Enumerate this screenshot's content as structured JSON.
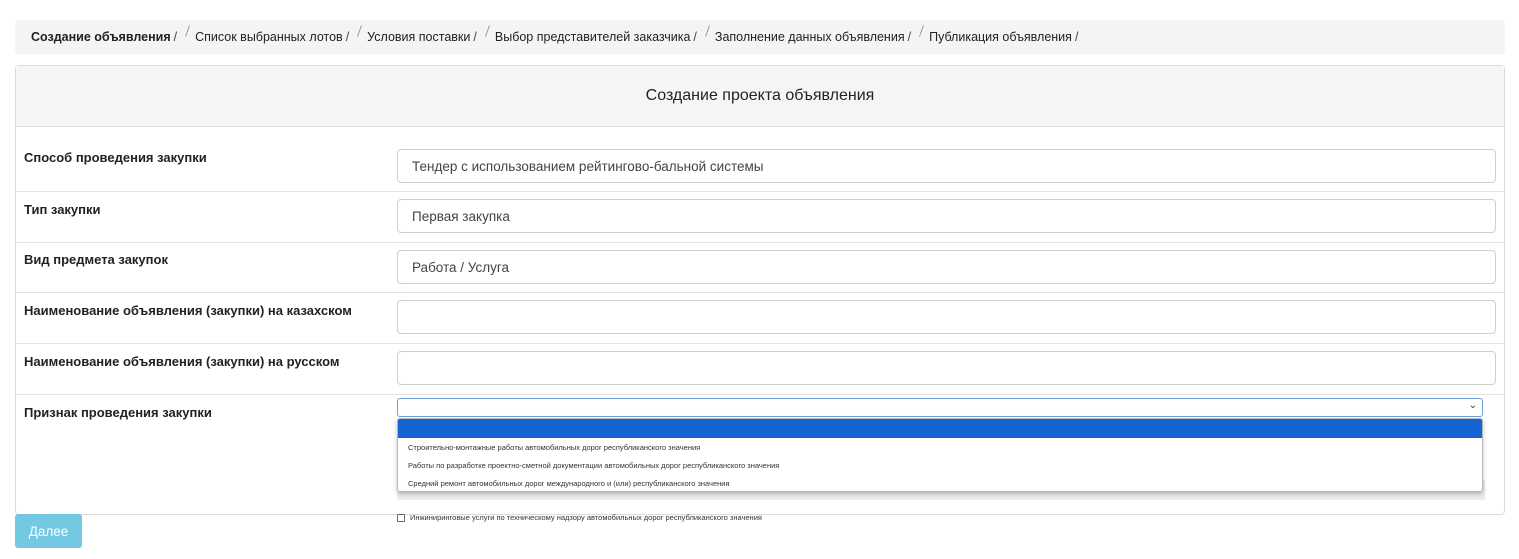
{
  "breadcrumb": {
    "items": [
      {
        "label": "Создание объявления",
        "active": true
      },
      {
        "label": "Список выбранных лотов",
        "active": false
      },
      {
        "label": "Условия поставки",
        "active": false
      },
      {
        "label": "Выбор представителей заказчика",
        "active": false
      },
      {
        "label": "Заполнение данных объявления",
        "active": false
      },
      {
        "label": "Публикация объявления",
        "active": false
      }
    ],
    "separator": "/"
  },
  "panel": {
    "title": "Создание проекта объявления",
    "fields": [
      {
        "label": "Способ проведения закупки",
        "value": "Тендер с использованием рейтингово-бальной системы"
      },
      {
        "label": "Тип закупки",
        "value": "Первая закупка"
      },
      {
        "label": "Вид предмета закупок",
        "value": "Работа / Услуга"
      },
      {
        "label": "Наименование объявления (закупки) на казахском",
        "value": ""
      },
      {
        "label": "Наименование объявления (закупки) на русском",
        "value": ""
      }
    ],
    "sign": {
      "label": "Признак проведения закупки",
      "selected": "",
      "options": [
        "",
        "Строительно-монтажные работы автомобильных дорог республиканского значения",
        "Работы по разработке проектно-сметной документации автомобильных дорог республиканского значения",
        "Средний ремонт автомобильных дорог международного и (или) республиканского значения"
      ],
      "checkbox_label": "Инжиниринговые услуги по техническому надзору автомобильных дорог республиканского значения"
    }
  },
  "actions": {
    "next_label": "Далее"
  },
  "colors": {
    "accent": "#5bc0de",
    "selected_option": "#1664d4"
  }
}
